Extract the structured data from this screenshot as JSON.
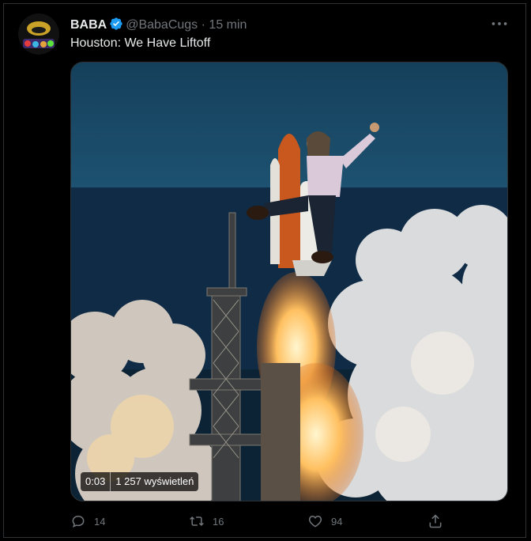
{
  "author": {
    "display_name": "BABA",
    "handle": "@BabaCugs",
    "separator": "·",
    "timestamp": "15 min",
    "verified": true
  },
  "tweet": {
    "text": "Houston: We Have Liftoff"
  },
  "video": {
    "elapsed": "0:03",
    "views": "1 257 wyświetleń"
  },
  "actions": {
    "replies": "14",
    "retweets": "16",
    "likes": "94"
  },
  "colors": {
    "background": "#000000",
    "text_primary": "#e7e9ea",
    "text_secondary": "#71767b",
    "verified_badge": "#1d9bf0"
  },
  "icons": {
    "more": "more-horizontal-icon",
    "reply": "reply-icon",
    "retweet": "retweet-icon",
    "like": "heart-icon",
    "share": "share-icon"
  }
}
